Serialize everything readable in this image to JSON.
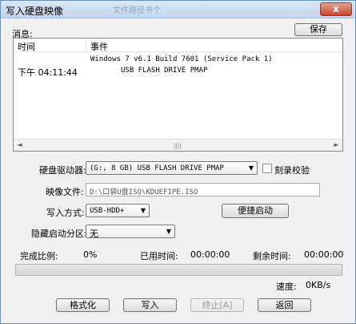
{
  "window": {
    "title": "写入硬盘映像",
    "bg_title_ghost": "文件路径书个",
    "close_label": "x"
  },
  "messages": {
    "label": "消息:",
    "save_label": "保存",
    "columns": [
      "时间",
      "事件"
    ],
    "rows": [
      {
        "time": "",
        "event": "Windows 7 v6.1 Build 7601 (Service Pack 1)"
      },
      {
        "time": "下午 04:11:44",
        "event": "USB FLASH DRIVE PMAP"
      }
    ],
    "scroll_left": "◄",
    "scroll_right": "►",
    "scroll_grip": "||||"
  },
  "form": {
    "drive_label": "硬盘驱动器:",
    "drive_value": "(G:, 8 GB)        USB FLASH DRIVE PMAP",
    "verify_label": "刻录校验",
    "image_label": "映像文件:",
    "image_path": "D:\\口袋U盘ISO\\KDUEFIPE.ISO",
    "method_label": "写入方式:",
    "method_value": "USB-HDD+",
    "quick_boot_label": "便捷启动",
    "hidden_partition_label": "隐藏启动分区:",
    "hidden_partition_value": "无",
    "arrow": "▼"
  },
  "status": {
    "complete_label": "完成比例:",
    "complete_value": "0%",
    "elapsed_label": "已用时间:",
    "elapsed_value": "00:00:00",
    "remaining_label": "剩余时间:",
    "remaining_value": "00:00:00",
    "progress": 0,
    "speed_label": "速度:",
    "speed_value": "0KB/s"
  },
  "buttons": {
    "format": "格式化",
    "write": "写入",
    "stop": "终止[A]",
    "back": "返回"
  }
}
